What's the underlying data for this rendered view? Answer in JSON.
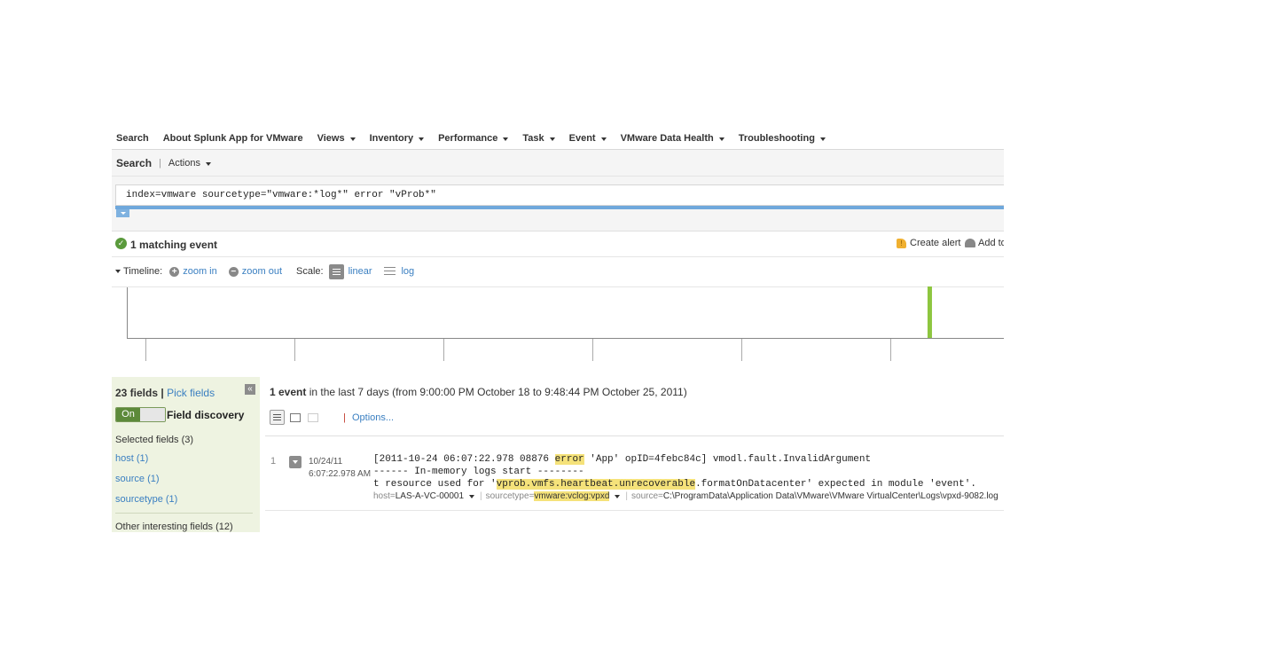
{
  "nav": {
    "items": [
      {
        "label": "Search",
        "caret": false
      },
      {
        "label": "About Splunk App for VMware",
        "caret": false
      },
      {
        "label": "Views",
        "caret": true
      },
      {
        "label": "Inventory",
        "caret": true
      },
      {
        "label": "Performance",
        "caret": true
      },
      {
        "label": "Task",
        "caret": true
      },
      {
        "label": "Event",
        "caret": true
      },
      {
        "label": "VMware Data Health",
        "caret": true
      },
      {
        "label": "Troubleshooting",
        "caret": true
      }
    ]
  },
  "searchbar": {
    "title": "Search",
    "separator": "|",
    "actions_label": "Actions"
  },
  "search": {
    "query": "index=vmware sourcetype=\"vmware:*log*\" error \"vProb*\""
  },
  "results_bar": {
    "match_text": "1 matching event",
    "create_alert": "Create alert",
    "add_to": "Add to"
  },
  "timeline_ctrl": {
    "label": "Timeline:",
    "zoom_in": "zoom in",
    "zoom_out": "zoom out",
    "scale_label": "Scale:",
    "linear": "linear",
    "log": "log"
  },
  "timeline": {
    "bar_position": 0.913,
    "bar_level": 1.0,
    "bar_color": "#8dc63f",
    "tick_count": 6
  },
  "sidebar": {
    "field_count": "23 fields",
    "pipe": "|",
    "pick_fields": "Pick fields",
    "collapse": "«",
    "toggle_on": "On",
    "field_discovery": "Field discovery",
    "selected_label": "Selected fields (3)",
    "selected_fields": [
      "host (1)",
      "source (1)",
      "sourcetype (1)"
    ],
    "other_label": "Other interesting fields (12)"
  },
  "results": {
    "count": "1 event",
    "range_text": " in the last 7 days (from 9:00:00 PM October 18 to 9:48:44 PM October 25, 2011)",
    "pipe": "|",
    "options": "Options..."
  },
  "event": {
    "number": "1",
    "date": "10/24/11",
    "time": "6:07:22.978 AM",
    "line1_pre": "[2011-10-24 06:07:22.978 08876 ",
    "line1_hl": "error",
    "line1_post": " 'App' opID=4febc84c] vmodl.fault.InvalidArgument",
    "line2": "------ In-memory logs start --------",
    "line3_pre": "t resource used for '",
    "line3_hl": "vprob.vmfs.heartbeat.unrecoverable",
    "line3_post": ".formatOnDatacenter' expected in module 'event'.",
    "meta": {
      "host_key": "host=",
      "host_val": "LAS-A-VC-00001",
      "sourcetype_key": "sourcetype=",
      "sourcetype_val": "vmware:vclog:vpxd",
      "source_key": "source=",
      "source_val": "C:\\ProgramData\\Application Data\\VMware\\VMware VirtualCenter\\Logs\\vpxd-9082.log",
      "sep": "|"
    }
  },
  "colors": {
    "accent_blue": "#6fa8dc",
    "link": "#3a7fc1",
    "sidebar_bg": "#eef3e1",
    "toggle_green": "#5d8a3a",
    "highlight": "#f5e27a"
  }
}
